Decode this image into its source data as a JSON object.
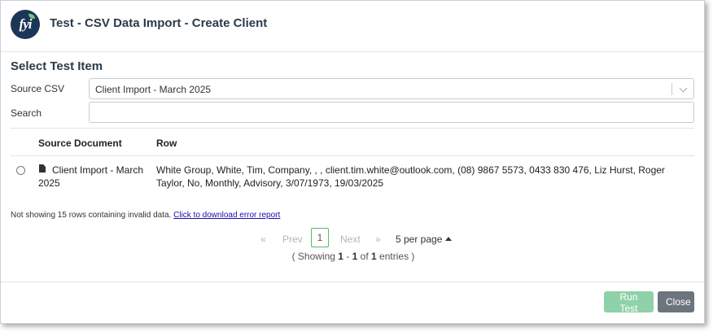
{
  "header": {
    "logo_text": "fyi",
    "title": "Test - CSV Data Import - Create Client"
  },
  "form": {
    "section_title": "Select Test Item",
    "source_label": "Source CSV",
    "source_value": "Client Import - March 2025",
    "search_label": "Search",
    "search_value": ""
  },
  "table": {
    "columns": [
      "Source Document",
      "Row"
    ],
    "rows": [
      {
        "selected": false,
        "document": "Client Import - March 2025",
        "row": "White Group, White, Tim, Company, , , client.tim.white@outlook.com, (08) 9867 5573, 0433 830 476, Liz Hurst, Roger Taylor, No, Monthly, Advisory, 3/07/1973, 19/03/2025"
      }
    ]
  },
  "note": {
    "text": "Not showing 15 rows containing invalid data.",
    "link": "Click to download error report"
  },
  "pagination": {
    "first": "«",
    "prev": "Prev",
    "current": "1",
    "next": "Next",
    "last": "»",
    "per_page": "5 per page",
    "showing_prefix": "( Showing ",
    "range_start": "1",
    "range_sep": " - ",
    "range_end": "1",
    "of": " of ",
    "total": "1",
    "entries": " entries )"
  },
  "footer": {
    "run_label": "Run Test",
    "close_label": "Close"
  },
  "colors": {
    "brand_navy": "#1b3658",
    "leaf_green": "#7cc36b",
    "run_button": "#8fd1a8",
    "close_button": "#6c757d",
    "page_active_border": "#5cb85c",
    "link": "#1a0dab"
  }
}
